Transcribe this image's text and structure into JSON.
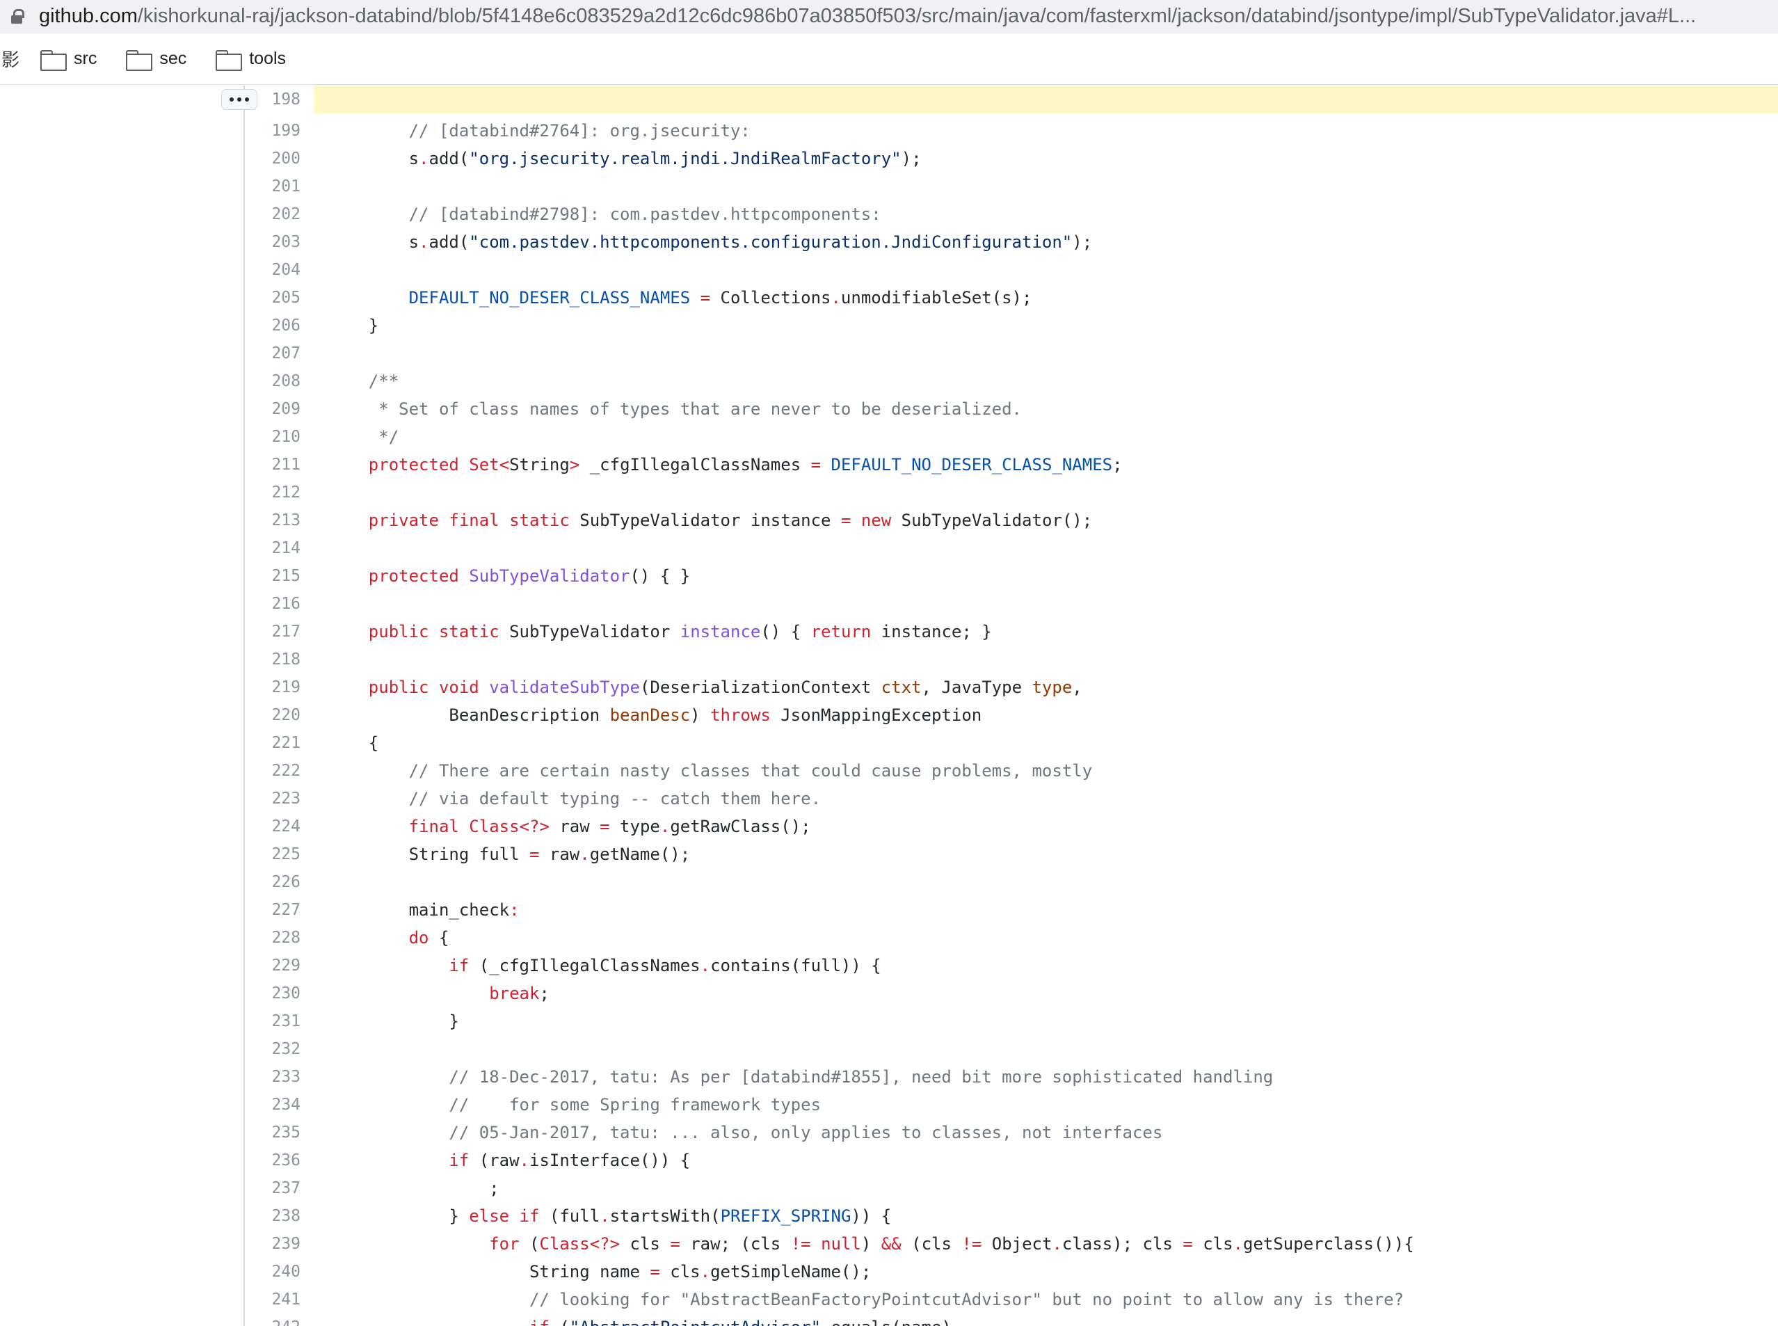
{
  "browser": {
    "url_host": "github.com",
    "url_path": "/kishorkunal-raj/jackson-databind/blob/5f4148e6c083529a2d12c6dc986b07a03850f503/src/main/java/com/fasterxml/jackson/databind/jsontype/impl/SubTypeValidator.java#L..."
  },
  "bookmarks": {
    "cut_item": "影",
    "items": [
      {
        "label": "src"
      },
      {
        "label": "sec"
      },
      {
        "label": "tools"
      }
    ]
  },
  "code": {
    "highlighted_line": "198",
    "lines": [
      {
        "n": "198",
        "t": ""
      },
      {
        "n": "199",
        "t": "        // [databind#2764]: org.jsecurity:"
      },
      {
        "n": "200",
        "t": "        s.add(\"org.jsecurity.realm.jndi.JndiRealmFactory\");"
      },
      {
        "n": "201",
        "t": ""
      },
      {
        "n": "202",
        "t": "        // [databind#2798]: com.pastdev.httpcomponents:"
      },
      {
        "n": "203",
        "t": "        s.add(\"com.pastdev.httpcomponents.configuration.JndiConfiguration\");"
      },
      {
        "n": "204",
        "t": ""
      },
      {
        "n": "205",
        "t": "        DEFAULT_NO_DESER_CLASS_NAMES = Collections.unmodifiableSet(s);"
      },
      {
        "n": "206",
        "t": "    }"
      },
      {
        "n": "207",
        "t": ""
      },
      {
        "n": "208",
        "t": "    /**"
      },
      {
        "n": "209",
        "t": "     * Set of class names of types that are never to be deserialized."
      },
      {
        "n": "210",
        "t": "     */"
      },
      {
        "n": "211",
        "t": "    protected Set<String> _cfgIllegalClassNames = DEFAULT_NO_DESER_CLASS_NAMES;"
      },
      {
        "n": "212",
        "t": ""
      },
      {
        "n": "213",
        "t": "    private final static SubTypeValidator instance = new SubTypeValidator();"
      },
      {
        "n": "214",
        "t": ""
      },
      {
        "n": "215",
        "t": "    protected SubTypeValidator() { }"
      },
      {
        "n": "216",
        "t": ""
      },
      {
        "n": "217",
        "t": "    public static SubTypeValidator instance() { return instance; }"
      },
      {
        "n": "218",
        "t": ""
      },
      {
        "n": "219",
        "t": "    public void validateSubType(DeserializationContext ctxt, JavaType type,"
      },
      {
        "n": "220",
        "t": "            BeanDescription beanDesc) throws JsonMappingException"
      },
      {
        "n": "221",
        "t": "    {"
      },
      {
        "n": "222",
        "t": "        // There are certain nasty classes that could cause problems, mostly"
      },
      {
        "n": "223",
        "t": "        // via default typing -- catch them here."
      },
      {
        "n": "224",
        "t": "        final Class<?> raw = type.getRawClass();"
      },
      {
        "n": "225",
        "t": "        String full = raw.getName();"
      },
      {
        "n": "226",
        "t": ""
      },
      {
        "n": "227",
        "t": "        main_check:"
      },
      {
        "n": "228",
        "t": "        do {"
      },
      {
        "n": "229",
        "t": "            if (_cfgIllegalClassNames.contains(full)) {"
      },
      {
        "n": "230",
        "t": "                break;"
      },
      {
        "n": "231",
        "t": "            }"
      },
      {
        "n": "232",
        "t": ""
      },
      {
        "n": "233",
        "t": "            // 18-Dec-2017, tatu: As per [databind#1855], need bit more sophisticated handling"
      },
      {
        "n": "234",
        "t": "            //    for some Spring framework types"
      },
      {
        "n": "235",
        "t": "            // 05-Jan-2017, tatu: ... also, only applies to classes, not interfaces"
      },
      {
        "n": "236",
        "t": "            if (raw.isInterface()) {"
      },
      {
        "n": "237",
        "t": "                ;"
      },
      {
        "n": "238",
        "t": "            } else if (full.startsWith(PREFIX_SPRING)) {"
      },
      {
        "n": "239",
        "t": "                for (Class<?> cls = raw; (cls != null) && (cls != Object.class); cls = cls.getSuperclass()){"
      },
      {
        "n": "240",
        "t": "                    String name = cls.getSimpleName();"
      },
      {
        "n": "241",
        "t": "                    // looking for \"AbstractBeanFactoryPointcutAdvisor\" but no point to allow any is there?"
      },
      {
        "n": "242",
        "t": "                    if (\"AbstractPointcutAdvisor\".equals(name)"
      }
    ]
  }
}
